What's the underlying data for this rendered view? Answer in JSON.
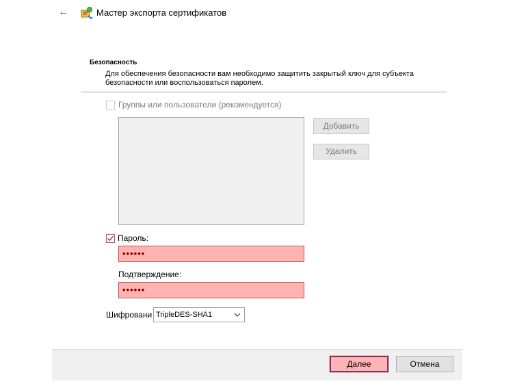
{
  "header": {
    "back_icon": "arrow-left-icon",
    "app_icon": "certificate-wizard-icon",
    "title": "Мастер экспорта сертификатов"
  },
  "section": {
    "heading": "Безопасность",
    "description": "Для обеспечения безопасности вам необходимо защитить закрытый ключ для субъекта безопасности или воспользоваться паролем."
  },
  "groups": {
    "label": "Группы или пользователи (рекомендуется)",
    "checked": false
  },
  "buttons": {
    "add": "Добавить",
    "remove": "Удалить",
    "next": "Далее",
    "cancel": "Отмена"
  },
  "password": {
    "label": "Пароль:",
    "checked": true,
    "value": "••••••",
    "confirm_label": "Подтверждение:",
    "confirm_value": "••••••"
  },
  "encryption": {
    "label": "Шифровани",
    "selected": "TripleDES-SHA1"
  },
  "colors": {
    "highlight": "#ffb3b3",
    "highlight_border": "#c0504d",
    "focus_border": "#6a3d6a"
  }
}
